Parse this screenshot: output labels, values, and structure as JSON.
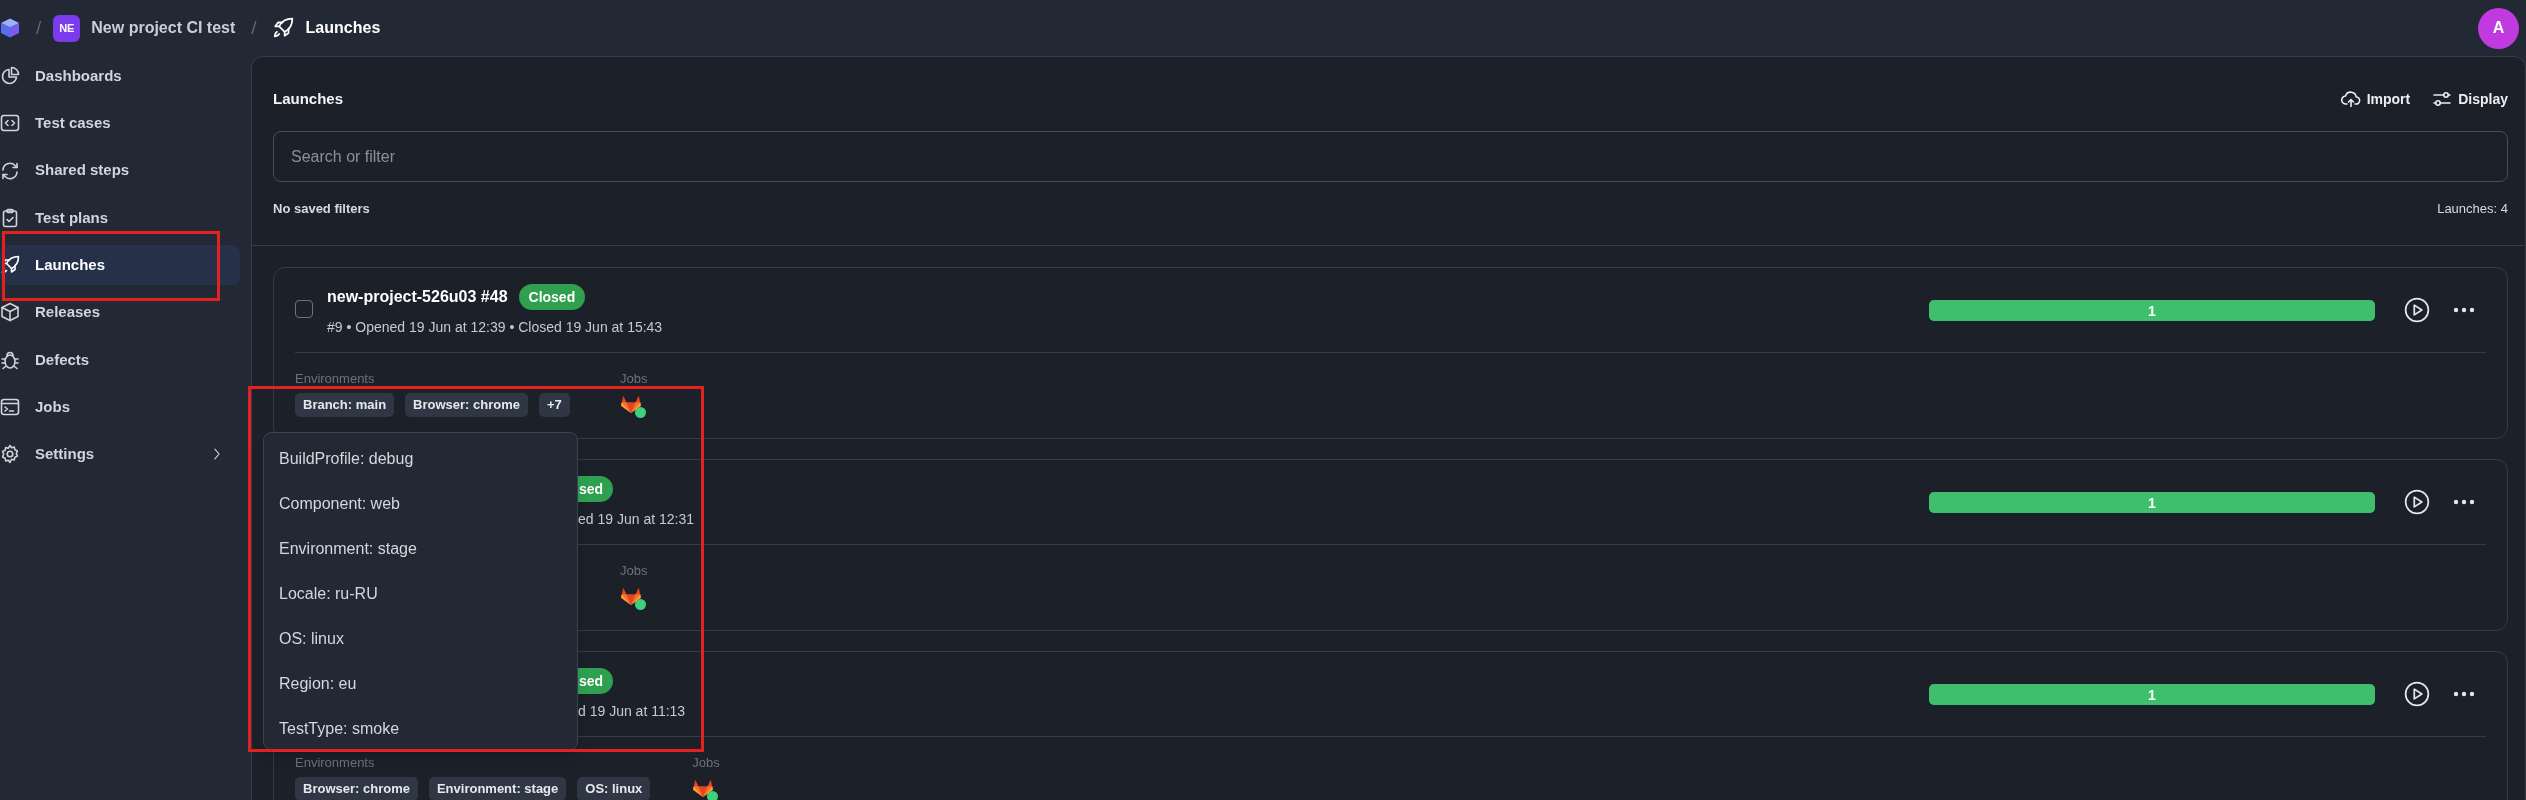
{
  "header": {
    "crumbs": [
      {
        "kind": "project",
        "separator": "/",
        "badge": "NE",
        "label": "New project CI test"
      },
      {
        "kind": "page",
        "separator": "/",
        "label": "Launches"
      }
    ],
    "avatar": "A"
  },
  "sidebar": {
    "items": [
      {
        "label": "Dashboards",
        "selected": false,
        "expandable": false
      },
      {
        "label": "Test cases",
        "selected": false,
        "expandable": false
      },
      {
        "label": "Shared steps",
        "selected": false,
        "expandable": false
      },
      {
        "label": "Test plans",
        "selected": false,
        "expandable": false
      },
      {
        "label": "Launches",
        "selected": true,
        "expandable": false
      },
      {
        "label": "Releases",
        "selected": false,
        "expandable": false
      },
      {
        "label": "Defects",
        "selected": false,
        "expandable": false
      },
      {
        "label": "Jobs",
        "selected": false,
        "expandable": false
      },
      {
        "label": "Settings",
        "selected": false,
        "expandable": true
      }
    ]
  },
  "main": {
    "title": "Launches",
    "actions": [
      {
        "label": "Import"
      },
      {
        "label": "Display"
      }
    ],
    "search": {
      "placeholder": "Search or filter"
    },
    "saved_filters": "No saved filters",
    "count": "Launches: 4"
  },
  "launches": [
    {
      "checked": false,
      "title": "new-project-526u03 #48",
      "status": "Closed",
      "meta": "#9 • Opened 19 Jun at 12:39 • Closed 19 Jun at 15:43",
      "progress": {
        "label": "1",
        "level": 1
      },
      "environments_label": "Environments",
      "environments": [
        "Branch: main",
        "Browser: chrome",
        "+7"
      ],
      "jobs_label": "Jobs",
      "jobs": [
        {
          "color": "#3fd17a"
        }
      ]
    },
    {
      "status": "sed",
      "meta": "ed 19 Jun at 12:31",
      "progress": {
        "label": "1",
        "level": 1
      },
      "jobs_label": "Jobs",
      "jobs": [
        {
          "color": "#3fd17a"
        }
      ]
    },
    {
      "status": "sed",
      "meta": "d 19 Jun at 11:13",
      "progress": {
        "label": "1",
        "level": 1
      },
      "environments_label": "Environments",
      "environments": [
        "Browser: chrome",
        "Environment: stage",
        "OS: linux"
      ],
      "jobs_label": "Jobs",
      "jobs": [
        {
          "color": "#3fd17a"
        }
      ]
    }
  ],
  "popup": {
    "items": [
      "BuildProfile: debug",
      "Component: web",
      "Environment: stage",
      "Locale: ru-RU",
      "OS: linux",
      "Region: eu",
      "TestType: smoke"
    ]
  }
}
